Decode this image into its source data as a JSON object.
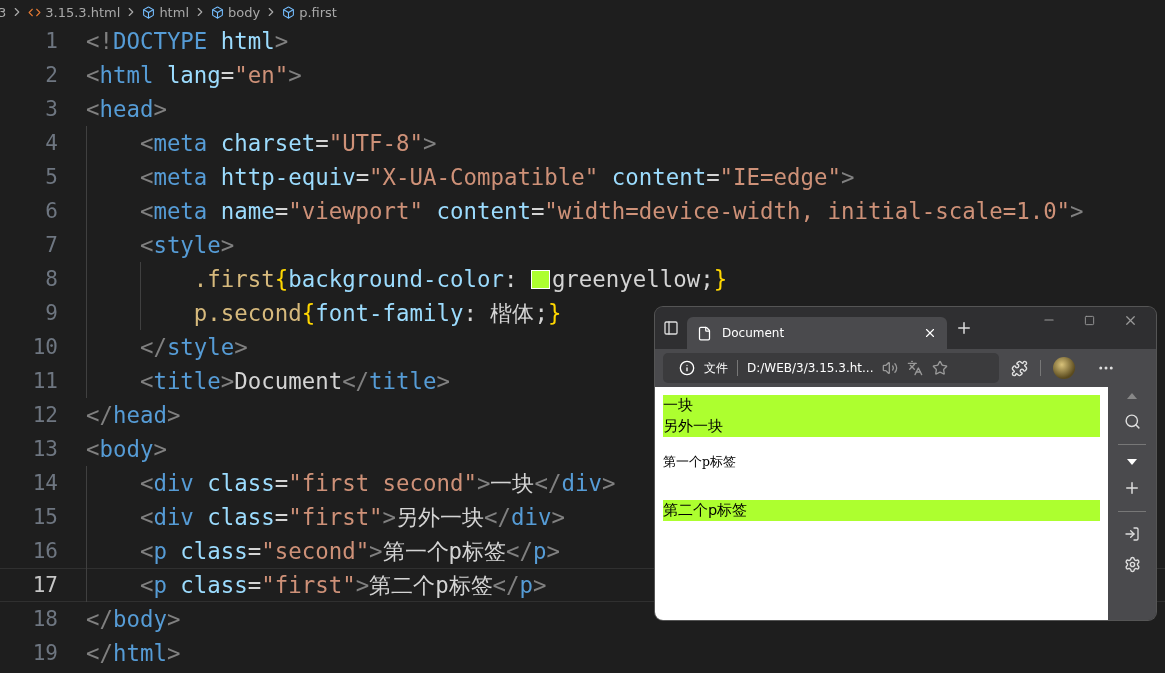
{
  "breadcrumb": [
    {
      "label": "3",
      "kind": "folder"
    },
    {
      "label": "3.15.3.html",
      "kind": "file"
    },
    {
      "label": "html",
      "kind": "element"
    },
    {
      "label": "body",
      "kind": "element"
    },
    {
      "label": "p.first",
      "kind": "element"
    }
  ],
  "editor": {
    "lines": [
      {
        "number": "1",
        "current": false,
        "tokens": [
          {
            "text": "<!",
            "kind": "punct"
          },
          {
            "text": "DOCTYPE",
            "kind": "tag"
          },
          {
            "text": " html",
            "kind": "attr"
          },
          {
            "text": ">",
            "kind": "punct"
          }
        ]
      },
      {
        "number": "2",
        "current": false,
        "tokens": [
          {
            "text": "<",
            "kind": "punct"
          },
          {
            "text": "html",
            "kind": "tag"
          },
          {
            "text": " lang",
            "kind": "attr"
          },
          {
            "text": "=",
            "kind": "plain"
          },
          {
            "text": "\"en\"",
            "kind": "string"
          },
          {
            "text": ">",
            "kind": "punct"
          }
        ]
      },
      {
        "number": "3",
        "current": false,
        "tokens": [
          {
            "text": "<",
            "kind": "punct"
          },
          {
            "text": "head",
            "kind": "tag"
          },
          {
            "text": ">",
            "kind": "punct"
          }
        ]
      },
      {
        "number": "4",
        "current": false,
        "tokens": [
          {
            "text": "    <",
            "kind": "punct"
          },
          {
            "text": "meta",
            "kind": "tag"
          },
          {
            "text": " charset",
            "kind": "attr"
          },
          {
            "text": "=",
            "kind": "plain"
          },
          {
            "text": "\"UTF-8\"",
            "kind": "string"
          },
          {
            "text": ">",
            "kind": "punct"
          }
        ]
      },
      {
        "number": "5",
        "current": false,
        "tokens": [
          {
            "text": "    <",
            "kind": "punct"
          },
          {
            "text": "meta",
            "kind": "tag"
          },
          {
            "text": " http-equiv",
            "kind": "attr"
          },
          {
            "text": "=",
            "kind": "plain"
          },
          {
            "text": "\"X-UA-Compatible\"",
            "kind": "string"
          },
          {
            "text": " content",
            "kind": "attr"
          },
          {
            "text": "=",
            "kind": "plain"
          },
          {
            "text": "\"IE=edge\"",
            "kind": "string"
          },
          {
            "text": ">",
            "kind": "punct"
          }
        ]
      },
      {
        "number": "6",
        "current": false,
        "tokens": [
          {
            "text": "    <",
            "kind": "punct"
          },
          {
            "text": "meta",
            "kind": "tag"
          },
          {
            "text": " name",
            "kind": "attr"
          },
          {
            "text": "=",
            "kind": "plain"
          },
          {
            "text": "\"viewport\"",
            "kind": "string"
          },
          {
            "text": " content",
            "kind": "attr"
          },
          {
            "text": "=",
            "kind": "plain"
          },
          {
            "text": "\"width=device-width, initial-scale=1.0\"",
            "kind": "string"
          },
          {
            "text": ">",
            "kind": "punct"
          }
        ]
      },
      {
        "number": "7",
        "current": false,
        "tokens": [
          {
            "text": "    <",
            "kind": "punct"
          },
          {
            "text": "style",
            "kind": "tag"
          },
          {
            "text": ">",
            "kind": "punct"
          }
        ]
      },
      {
        "number": "8",
        "current": false,
        "tokens": [
          {
            "text": "        .first",
            "kind": "selector"
          },
          {
            "text": "{",
            "kind": "brace"
          },
          {
            "text": "background-color",
            "kind": "prop"
          },
          {
            "text": ": ",
            "kind": "plain"
          },
          {
            "kind": "swatch",
            "color": "#adff2f"
          },
          {
            "text": "greenyellow;",
            "kind": "plain"
          },
          {
            "text": "}",
            "kind": "brace"
          }
        ]
      },
      {
        "number": "9",
        "current": false,
        "tokens": [
          {
            "text": "        p.second",
            "kind": "selector"
          },
          {
            "text": "{",
            "kind": "brace"
          },
          {
            "text": "font-family",
            "kind": "prop"
          },
          {
            "text": ": 楷体;",
            "kind": "plain"
          },
          {
            "text": "}",
            "kind": "brace"
          }
        ]
      },
      {
        "number": "10",
        "current": false,
        "tokens": [
          {
            "text": "    </",
            "kind": "punct"
          },
          {
            "text": "style",
            "kind": "tag"
          },
          {
            "text": ">",
            "kind": "punct"
          }
        ]
      },
      {
        "number": "11",
        "current": false,
        "tokens": [
          {
            "text": "    <",
            "kind": "punct"
          },
          {
            "text": "title",
            "kind": "tag"
          },
          {
            "text": ">",
            "kind": "punct"
          },
          {
            "text": "Document",
            "kind": "plain"
          },
          {
            "text": "</",
            "kind": "punct"
          },
          {
            "text": "title",
            "kind": "tag"
          },
          {
            "text": ">",
            "kind": "punct"
          }
        ]
      },
      {
        "number": "12",
        "current": false,
        "tokens": [
          {
            "text": "</",
            "kind": "punct"
          },
          {
            "text": "head",
            "kind": "tag"
          },
          {
            "text": ">",
            "kind": "punct"
          }
        ]
      },
      {
        "number": "13",
        "current": false,
        "tokens": [
          {
            "text": "<",
            "kind": "punct"
          },
          {
            "text": "body",
            "kind": "tag"
          },
          {
            "text": ">",
            "kind": "punct"
          }
        ]
      },
      {
        "number": "14",
        "current": false,
        "tokens": [
          {
            "text": "    <",
            "kind": "punct"
          },
          {
            "text": "div",
            "kind": "tag"
          },
          {
            "text": " class",
            "kind": "attr"
          },
          {
            "text": "=",
            "kind": "plain"
          },
          {
            "text": "\"first second\"",
            "kind": "string"
          },
          {
            "text": ">",
            "kind": "punct"
          },
          {
            "text": "一块",
            "kind": "plain"
          },
          {
            "text": "</",
            "kind": "punct"
          },
          {
            "text": "div",
            "kind": "tag"
          },
          {
            "text": ">",
            "kind": "punct"
          }
        ]
      },
      {
        "number": "15",
        "current": false,
        "tokens": [
          {
            "text": "    <",
            "kind": "punct"
          },
          {
            "text": "div",
            "kind": "tag"
          },
          {
            "text": " class",
            "kind": "attr"
          },
          {
            "text": "=",
            "kind": "plain"
          },
          {
            "text": "\"first\"",
            "kind": "string"
          },
          {
            "text": ">",
            "kind": "punct"
          },
          {
            "text": "另外一块",
            "kind": "plain"
          },
          {
            "text": "</",
            "kind": "punct"
          },
          {
            "text": "div",
            "kind": "tag"
          },
          {
            "text": ">",
            "kind": "punct"
          }
        ]
      },
      {
        "number": "16",
        "current": false,
        "tokens": [
          {
            "text": "    <",
            "kind": "punct"
          },
          {
            "text": "p",
            "kind": "tag"
          },
          {
            "text": " class",
            "kind": "attr"
          },
          {
            "text": "=",
            "kind": "plain"
          },
          {
            "text": "\"second\"",
            "kind": "string"
          },
          {
            "text": ">",
            "kind": "punct"
          },
          {
            "text": "第一个p标签",
            "kind": "plain"
          },
          {
            "text": "</",
            "kind": "punct"
          },
          {
            "text": "p",
            "kind": "tag"
          },
          {
            "text": ">",
            "kind": "punct"
          }
        ]
      },
      {
        "number": "17",
        "current": true,
        "tokens": [
          {
            "text": "    <",
            "kind": "punct"
          },
          {
            "text": "p",
            "kind": "tag"
          },
          {
            "text": " class",
            "kind": "attr"
          },
          {
            "text": "=",
            "kind": "plain"
          },
          {
            "text": "\"first\"",
            "kind": "string"
          },
          {
            "text": ">",
            "kind": "punct"
          },
          {
            "text": "第二个p标签",
            "kind": "plain"
          },
          {
            "text": "</",
            "kind": "punct"
          },
          {
            "text": "p",
            "kind": "tag"
          },
          {
            "text": ">",
            "kind": "punct"
          }
        ]
      },
      {
        "number": "18",
        "current": false,
        "tokens": [
          {
            "text": "</",
            "kind": "punct"
          },
          {
            "text": "body",
            "kind": "tag"
          },
          {
            "text": ">",
            "kind": "punct"
          }
        ]
      },
      {
        "number": "19",
        "current": false,
        "tokens": [
          {
            "text": "</",
            "kind": "punct"
          },
          {
            "text": "html",
            "kind": "tag"
          },
          {
            "text": ">",
            "kind": "punct"
          }
        ]
      }
    ]
  },
  "browser": {
    "tab": {
      "title": "Document",
      "selected": true
    },
    "address": {
      "security": "文件",
      "url": "D:/WEB/3/3.15.3.ht..."
    },
    "content": [
      {
        "kind": "div",
        "text": "一块",
        "highlighted": true,
        "calligraphic": false
      },
      {
        "kind": "div",
        "text": "另外一块",
        "highlighted": true,
        "calligraphic": false
      },
      {
        "kind": "p",
        "text": "第一个p标签",
        "highlighted": false,
        "calligraphic": true
      },
      {
        "kind": "p",
        "text": "第二个p标签",
        "highlighted": true,
        "calligraphic": false
      }
    ]
  }
}
